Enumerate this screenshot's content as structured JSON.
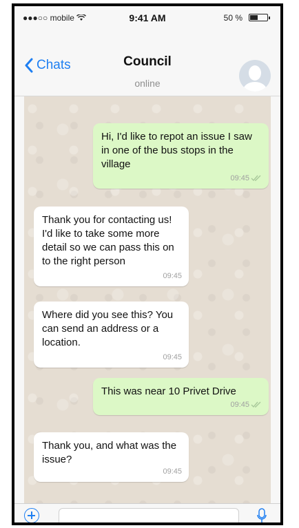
{
  "status_bar": {
    "carrier": "●●●○○ mobile",
    "time": "9:41 AM",
    "battery_percent": "50 %",
    "battery_level": 0.5
  },
  "nav": {
    "back_label": "Chats",
    "title": "Council",
    "subtitle": "online"
  },
  "messages": [
    {
      "direction": "out",
      "text": "Hi, I'd like to repot an issue I saw in one of the bus stops in the village",
      "time": "09:45",
      "read": true
    },
    {
      "direction": "in",
      "text": "Thank you for contacting us! I'd like to take some more detail so we can pass this on to the right person",
      "time": "09:45"
    },
    {
      "direction": "in",
      "text": "Where did you see this? You can send an address or a location.",
      "time": "09:45"
    },
    {
      "direction": "out",
      "text": "This was near 10 Privet Drive",
      "time": "09:45",
      "read": true
    },
    {
      "direction": "in",
      "text": "Thank you, and what was the issue?",
      "time": "09:45"
    }
  ],
  "colors": {
    "accent": "#1e7ff2",
    "outgoing_bubble": "#dcf8c6",
    "incoming_bubble": "#ffffff",
    "chat_background": "#e5ddd2"
  },
  "icons": {
    "back": "chevron-left-icon",
    "wifi": "wifi-icon",
    "battery": "battery-icon",
    "avatar": "user-avatar-icon",
    "attach": "plus-icon",
    "mic": "microphone-icon",
    "read_receipt": "double-check-icon"
  }
}
